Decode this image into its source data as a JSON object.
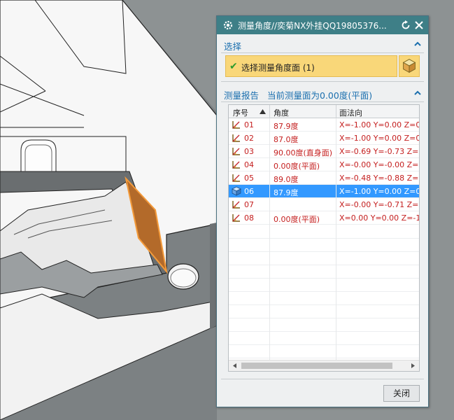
{
  "dialog": {
    "title": "测量角度//奕菊NX外挂QQ19805376...",
    "select_section": {
      "title": "选择",
      "item_label": "选择测量角度面 (1)"
    },
    "report_section": {
      "title": "测量报告",
      "info": "当前测量面为0.00度(平面)"
    },
    "table": {
      "columns": [
        "序号",
        "角度",
        "面法向"
      ],
      "rows": [
        {
          "num": "01",
          "angle": "87.9度",
          "normal": "X=-1.00 Y=0.00 Z=0.",
          "icon": "angle-face-icon"
        },
        {
          "num": "02",
          "angle": "87.0度",
          "normal": "X=-1.00 Y=0.00 Z=0.",
          "icon": "angle-face-icon"
        },
        {
          "num": "03",
          "angle": "90.00度(直身面)",
          "normal": "X=-0.69 Y=-0.73 Z=0",
          "icon": "angle-face-icon"
        },
        {
          "num": "04",
          "angle": "0.00度(平面)",
          "normal": "X=-0.00 Y=-0.00 Z=1",
          "icon": "angle-face-icon"
        },
        {
          "num": "05",
          "angle": "89.0度",
          "normal": "X=-0.48 Y=-0.88 Z=0",
          "icon": "angle-face-icon"
        },
        {
          "num": "06",
          "angle": "87.9度",
          "normal": "X=-1.00 Y=0.00 Z=0.",
          "icon": "solid-cube-icon",
          "selected": true
        },
        {
          "num": "07",
          "angle": "",
          "normal": "X=-0.00 Y=-0.71 Z=0",
          "icon": "angle-face-icon"
        },
        {
          "num": "08",
          "angle": "0.00度(平面)",
          "normal": "X=0.00 Y=0.00 Z=-1.",
          "icon": "angle-face-icon"
        }
      ]
    },
    "close_label": "关闭"
  },
  "colors": {
    "title_bar": "#3e7f87",
    "section_text": "#1b6fae",
    "selection_fill": "#f9d779",
    "row_text": "#c41e1e",
    "row_selected": "#3399ff",
    "face_highlight": "#c8823f"
  }
}
